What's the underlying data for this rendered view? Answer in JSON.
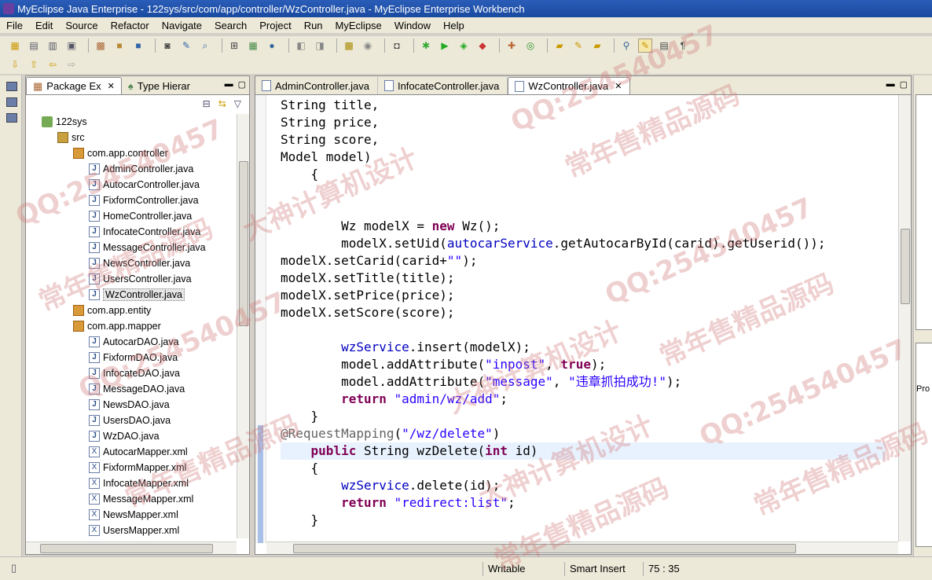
{
  "window": {
    "title": "MyEclipse Java Enterprise - 122sys/src/com/app/controller/WzController.java - MyEclipse Enterprise Workbench"
  },
  "menu": [
    "File",
    "Edit",
    "Source",
    "Refactor",
    "Navigate",
    "Search",
    "Project",
    "Run",
    "MyEclipse",
    "Window",
    "Help"
  ],
  "explorer": {
    "tabs": [
      {
        "label": "Package Ex",
        "close": "✕"
      },
      {
        "label": "Type Hierar"
      }
    ],
    "tree": [
      {
        "label": "122sys",
        "icon": "project-icon",
        "indent": 0
      },
      {
        "label": "src",
        "icon": "source-folder-icon",
        "indent": 1
      },
      {
        "label": "com.app.controller",
        "icon": "package-icon",
        "indent": 2
      },
      {
        "label": "AdminController.java",
        "icon": "java-file-icon",
        "indent": 3
      },
      {
        "label": "AutocarController.java",
        "icon": "java-file-icon",
        "indent": 3
      },
      {
        "label": "FixformController.java",
        "icon": "java-file-icon",
        "indent": 3
      },
      {
        "label": "HomeController.java",
        "icon": "java-file-icon",
        "indent": 3
      },
      {
        "label": "InfocateController.java",
        "icon": "java-file-icon",
        "indent": 3
      },
      {
        "label": "MessageController.java",
        "icon": "java-file-icon",
        "indent": 3
      },
      {
        "label": "NewsController.java",
        "icon": "java-file-icon",
        "indent": 3
      },
      {
        "label": "UsersController.java",
        "icon": "java-file-icon",
        "indent": 3
      },
      {
        "label": "WzController.java",
        "icon": "java-file-icon",
        "indent": 3,
        "selected": true
      },
      {
        "label": "com.app.entity",
        "icon": "package-icon",
        "indent": 2
      },
      {
        "label": "com.app.mapper",
        "icon": "package-icon",
        "indent": 2
      },
      {
        "label": "AutocarDAO.java",
        "icon": "java-file-icon",
        "indent": 3
      },
      {
        "label": "FixformDAO.java",
        "icon": "java-file-icon",
        "indent": 3
      },
      {
        "label": "InfocateDAO.java",
        "icon": "java-file-icon",
        "indent": 3
      },
      {
        "label": "MessageDAO.java",
        "icon": "java-file-icon",
        "indent": 3
      },
      {
        "label": "NewsDAO.java",
        "icon": "java-file-icon",
        "indent": 3
      },
      {
        "label": "UsersDAO.java",
        "icon": "java-file-icon",
        "indent": 3
      },
      {
        "label": "WzDAO.java",
        "icon": "java-file-icon",
        "indent": 3
      },
      {
        "label": "AutocarMapper.xml",
        "icon": "xml-file-icon",
        "indent": 3
      },
      {
        "label": "FixformMapper.xml",
        "icon": "xml-file-icon",
        "indent": 3
      },
      {
        "label": "InfocateMapper.xml",
        "icon": "xml-file-icon",
        "indent": 3
      },
      {
        "label": "MessageMapper.xml",
        "icon": "xml-file-icon",
        "indent": 3
      },
      {
        "label": "NewsMapper.xml",
        "icon": "xml-file-icon",
        "indent": 3
      },
      {
        "label": "UsersMapper.xml",
        "icon": "xml-file-icon",
        "indent": 3
      }
    ]
  },
  "editor": {
    "tabs": [
      {
        "label": "AdminController.java"
      },
      {
        "label": "InfocateController.java"
      },
      {
        "label": "WzController.java",
        "active": true,
        "close": "✕"
      }
    ],
    "lines": [
      [
        [
          "String title,",
          ""
        ]
      ],
      [
        [
          "String price,",
          ""
        ]
      ],
      [
        [
          "String score,",
          ""
        ]
      ],
      [
        [
          "Model model)",
          ""
        ]
      ],
      [
        [
          "    {",
          ""
        ]
      ],
      [
        [
          "",
          ""
        ]
      ],
      [
        [
          "",
          ""
        ]
      ],
      [
        [
          "        Wz modelX = ",
          ""
        ],
        [
          "new",
          "kw"
        ],
        [
          " Wz();",
          ""
        ]
      ],
      [
        [
          "        modelX.setUid(",
          ""
        ],
        [
          "autocarService",
          "fld"
        ],
        [
          ".getAutocarById(carid).getUserid());",
          ""
        ]
      ],
      [
        [
          "modelX.setCarid(carid+",
          ""
        ],
        [
          "\"\"",
          "str"
        ],
        [
          ");",
          ""
        ]
      ],
      [
        [
          "modelX.setTitle(title);",
          ""
        ]
      ],
      [
        [
          "modelX.setPrice(price);",
          ""
        ]
      ],
      [
        [
          "modelX.setScore(score);",
          ""
        ]
      ],
      [
        [
          "",
          ""
        ]
      ],
      [
        [
          "        ",
          ""
        ],
        [
          "wzService",
          "fld"
        ],
        [
          ".insert(modelX);",
          ""
        ]
      ],
      [
        [
          "        model.addAttribute(",
          ""
        ],
        [
          "\"inpost\"",
          "str"
        ],
        [
          ", ",
          ""
        ],
        [
          "true",
          "kw"
        ],
        [
          ");",
          ""
        ]
      ],
      [
        [
          "        model.addAttribute(",
          ""
        ],
        [
          "\"message\"",
          "str"
        ],
        [
          ", ",
          ""
        ],
        [
          "\"违章抓拍成功!\"",
          "str"
        ],
        [
          ");",
          ""
        ]
      ],
      [
        [
          "        ",
          ""
        ],
        [
          "return",
          "kw"
        ],
        [
          " ",
          ""
        ],
        [
          "\"admin/wz/add\"",
          "str"
        ],
        [
          ";",
          ""
        ]
      ],
      [
        [
          "    }",
          ""
        ]
      ],
      [
        [
          "@RequestMapping",
          "ann"
        ],
        [
          "(",
          ""
        ],
        [
          "\"/wz/delete\"",
          "str"
        ],
        [
          ")",
          ""
        ]
      ],
      [
        [
          "    ",
          ""
        ],
        [
          "public",
          "kw"
        ],
        [
          " String wzDelete(",
          ""
        ],
        [
          "int",
          "kw"
        ],
        [
          " id)",
          ""
        ]
      ],
      [
        [
          "    {",
          ""
        ]
      ],
      [
        [
          "        ",
          ""
        ],
        [
          "wzService",
          "fld"
        ],
        [
          ".delete(id);",
          ""
        ]
      ],
      [
        [
          "        ",
          ""
        ],
        [
          "return",
          "kw"
        ],
        [
          " ",
          ""
        ],
        [
          "\"redirect:list\"",
          "str"
        ],
        [
          ";",
          ""
        ]
      ],
      [
        [
          "    }",
          ""
        ]
      ]
    ],
    "current_line_index": 20,
    "fold_line_index": 19
  },
  "right_panel": {
    "label": "Pro"
  },
  "status": {
    "mode": "Writable",
    "insert": "Smart Insert",
    "position": "75 : 35"
  },
  "watermark": {
    "lines": [
      "QQ:254540457",
      "大神计算机设计",
      "常年售精品源码"
    ]
  }
}
